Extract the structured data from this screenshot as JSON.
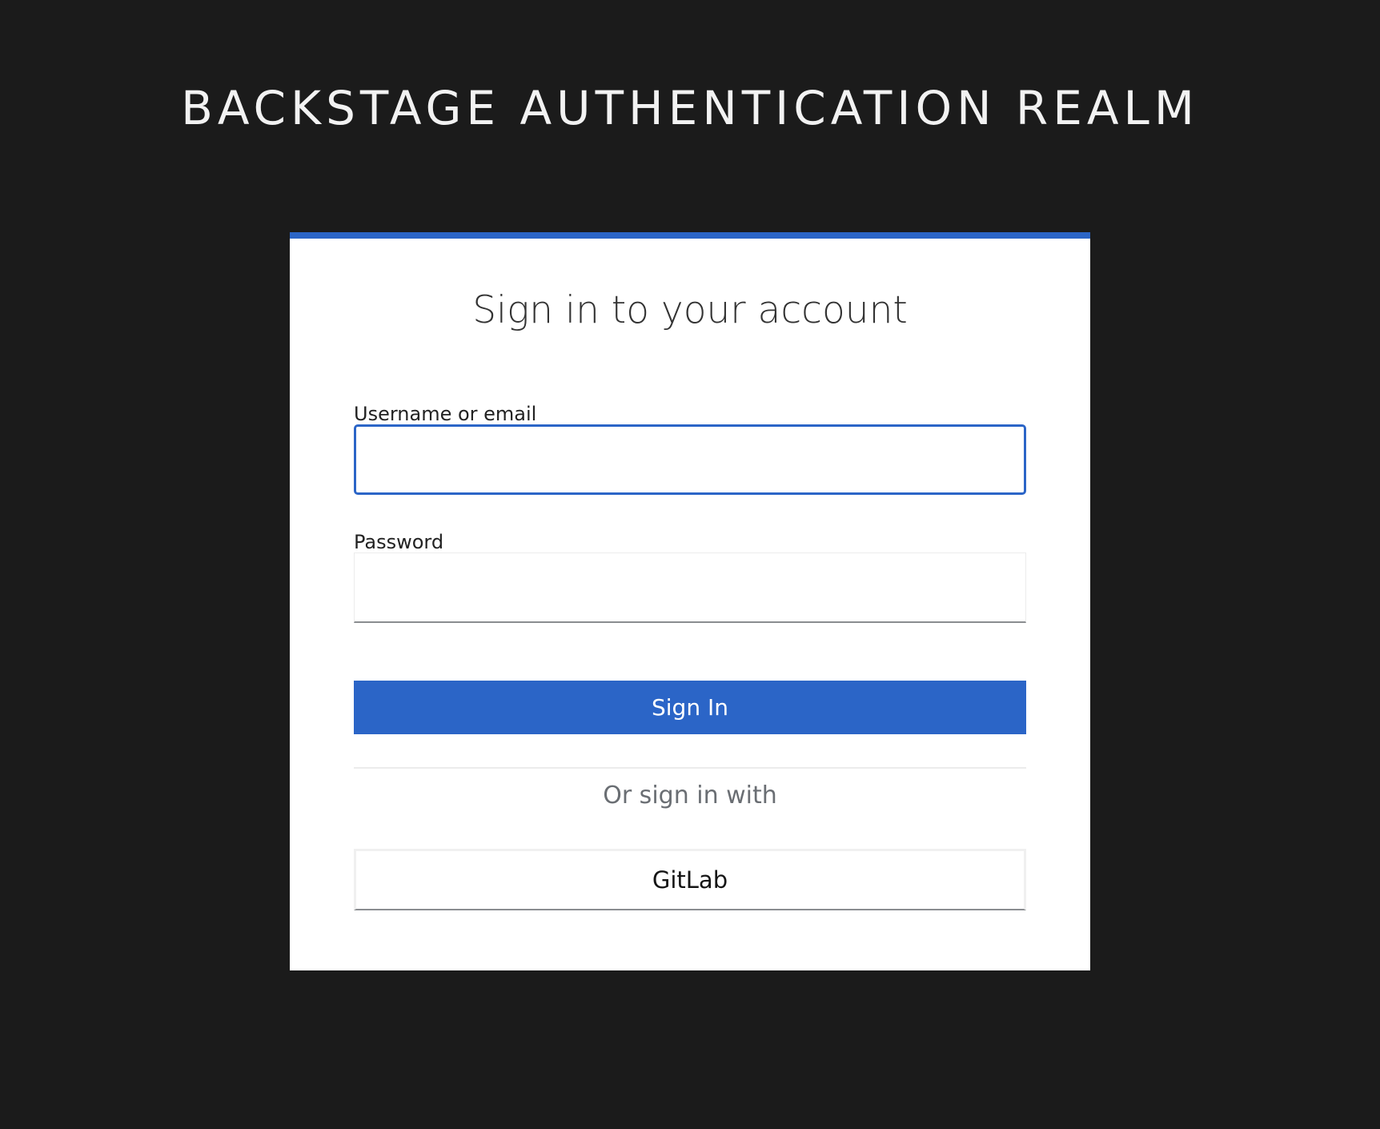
{
  "page": {
    "realm_title": "BACKSTAGE AUTHENTICATION REALM"
  },
  "login_card": {
    "heading": "Sign in to your account",
    "username_label": "Username or email",
    "username_value": "",
    "password_label": "Password",
    "password_value": "",
    "submit_label": "Sign In",
    "alternate_text": "Or sign in with",
    "providers": [
      {
        "label": "GitLab"
      }
    ]
  },
  "colors": {
    "background": "#1b1b1b",
    "accent": "#2b65c7",
    "card": "#ffffff"
  }
}
